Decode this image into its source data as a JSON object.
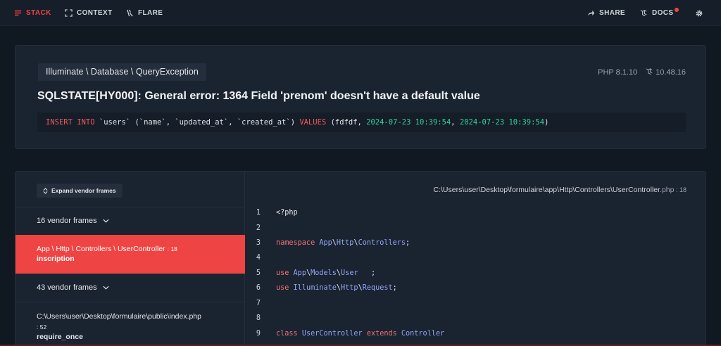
{
  "nav": {
    "stack": "STACK",
    "context": "CONTEXT",
    "flare": "FLARE",
    "share": "SHARE",
    "docs": "DOCS"
  },
  "exception": {
    "class_parts": [
      "Illuminate",
      "Database",
      "QueryException"
    ],
    "php_version": "PHP 8.1.10",
    "laravel_version": "10.48.16",
    "message": "SQLSTATE[HY000]: General error: 1364 Field 'prenom' doesn't have a default value",
    "sql": {
      "insert": "INSERT INTO",
      "table_part": " `users` (`name`, `updated_at`, `created_at`) ",
      "values": "VALUES",
      "open": " (fdfdf, ",
      "date1": "2024-07-23 10:39:54",
      "sep": ", ",
      "date2": "2024-07-23 10:39:54",
      "close": ")"
    }
  },
  "frames": {
    "expand_label": "Expand vendor frames",
    "vendor_group_1": "16 vendor frames",
    "selected_path": "App \\ Http \\ Controllers \\ UserController",
    "selected_line": ": 18",
    "selected_method": "inscription",
    "vendor_group_2": "43 vendor frames",
    "last_path": "C:\\Users\\user\\Desktop\\formulaire\\public\\index.php",
    "last_line": ": 52",
    "last_method": "require_once"
  },
  "code": {
    "file_path": "C:\\Users\\user\\Desktop\\formulaire\\app\\Http\\Controllers\\UserController",
    "file_ext": ".php",
    "file_line": " : 18",
    "lines": [
      {
        "num": "1",
        "src": "<?php"
      },
      {
        "num": "2",
        "src": ""
      },
      {
        "num": "3",
        "src": "namespace App\\Http\\Controllers;"
      },
      {
        "num": "4",
        "src": ""
      },
      {
        "num": "5",
        "src": "use App\\Models\\User   ;"
      },
      {
        "num": "6",
        "src": "use Illuminate\\Http\\Request;"
      },
      {
        "num": "7",
        "src": ""
      },
      {
        "num": "8",
        "src": ""
      },
      {
        "num": "9",
        "src": "class UserController extends Controller"
      }
    ]
  },
  "colors": {
    "accent": "#ef4444",
    "background": "#101821",
    "card": "#1a2330"
  },
  "icons": {
    "stack": "stack-layers-icon",
    "context": "context-brackets-icon",
    "flare": "flare-icon",
    "share": "share-arrow-icon",
    "docs": "laravel-docs-icon",
    "settings": "gear-icon",
    "expand": "chevron-up-down-icon",
    "group": "chevron-down-icon"
  }
}
